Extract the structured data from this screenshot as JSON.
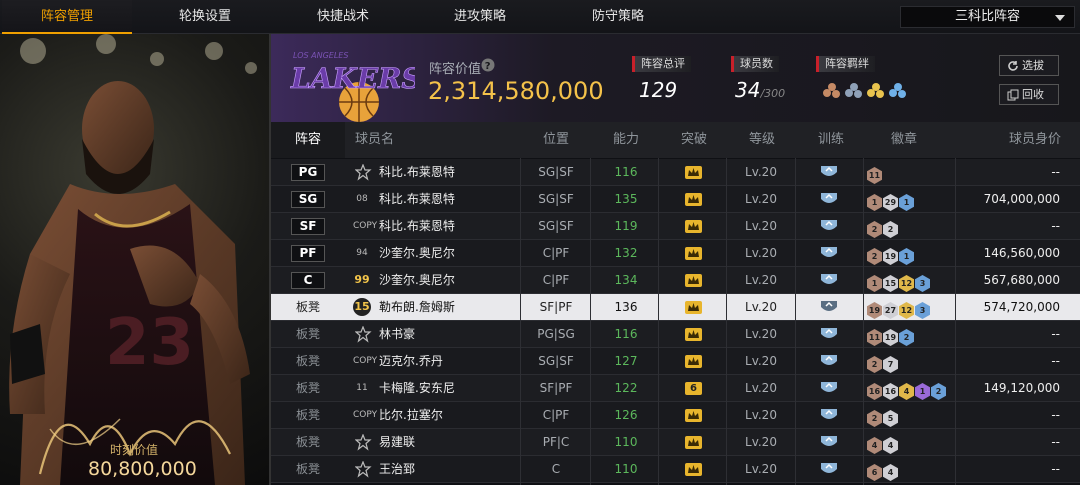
{
  "nav": {
    "tabs": [
      "阵容管理",
      "轮换设置",
      "快捷战术",
      "进攻策略",
      "防守策略"
    ],
    "active": 0,
    "dropdown": "三科比阵容"
  },
  "hero": {
    "value_caption": "时刻价值",
    "value": "80,800,000",
    "jersey": "23"
  },
  "summary": {
    "team_logo_text": "LAKERS",
    "team_logo_subtext": "LOS ANGELES",
    "value_label": "阵容价值",
    "value": "2,314,580,000",
    "rating_label": "阵容总评",
    "rating": "129",
    "players_label": "球员数",
    "players": "34",
    "players_max": "/300",
    "bonds_label": "阵容羁绊",
    "btn_pick": "选拔",
    "btn_recycle": "回收"
  },
  "table": {
    "headers": [
      "阵容",
      "球员名",
      "位置",
      "能力",
      "突破",
      "等级",
      "训练",
      "徽章",
      "球员身价"
    ],
    "rows": [
      {
        "slot": "PG",
        "starter": true,
        "num": "★",
        "name": "科比.布莱恩特",
        "pos": "SG|SF",
        "ability": "116",
        "break": "",
        "level": "Lv.20",
        "badges": [
          {
            "n": "11",
            "c": "#b08a78"
          }
        ],
        "price": "--"
      },
      {
        "slot": "SG",
        "starter": true,
        "num": "08",
        "name": "科比.布莱恩特",
        "pos": "SG|SF",
        "ability": "135",
        "break": "",
        "level": "Lv.20",
        "badges": [
          {
            "n": "1",
            "c": "#b08a78"
          },
          {
            "n": "29",
            "c": "#cfcfd4"
          },
          {
            "n": "1",
            "c": "#6aa0d8"
          }
        ],
        "price": "704,000,000"
      },
      {
        "slot": "SF",
        "starter": true,
        "num": "COPY",
        "name": "科比.布莱恩特",
        "pos": "SG|SF",
        "ability": "119",
        "break": "",
        "level": "Lv.20",
        "badges": [
          {
            "n": "2",
            "c": "#b08a78"
          },
          {
            "n": "2",
            "c": "#cfcfd4"
          }
        ],
        "price": "--"
      },
      {
        "slot": "PF",
        "starter": true,
        "num": "94",
        "name": "沙奎尔.奥尼尔",
        "pos": "C|PF",
        "ability": "132",
        "break": "",
        "level": "Lv.20",
        "badges": [
          {
            "n": "2",
            "c": "#b08a78"
          },
          {
            "n": "19",
            "c": "#cfcfd4"
          },
          {
            "n": "1",
            "c": "#6aa0d8"
          }
        ],
        "price": "146,560,000"
      },
      {
        "slot": "C",
        "starter": true,
        "num": "99",
        "name": "沙奎尔.奥尼尔",
        "pos": "C|PF",
        "ability": "134",
        "break": "",
        "level": "Lv.20",
        "badges": [
          {
            "n": "1",
            "c": "#b08a78"
          },
          {
            "n": "15",
            "c": "#cfcfd4"
          },
          {
            "n": "12",
            "c": "#e0b84a"
          },
          {
            "n": "3",
            "c": "#6aa0d8"
          }
        ],
        "price": "567,680,000"
      },
      {
        "slot": "板凳",
        "starter": false,
        "num": "15",
        "name": "勒布朗.詹姆斯",
        "pos": "SF|PF",
        "ability": "136",
        "break": "",
        "level": "Lv.20",
        "badges": [
          {
            "n": "19",
            "c": "#b08a78"
          },
          {
            "n": "27",
            "c": "#cfcfd4"
          },
          {
            "n": "12",
            "c": "#e0b84a"
          },
          {
            "n": "3",
            "c": "#6aa0d8"
          }
        ],
        "price": "574,720,000",
        "selected": true
      },
      {
        "slot": "板凳",
        "starter": false,
        "num": "★",
        "name": "林书豪",
        "pos": "PG|SG",
        "ability": "116",
        "break": "",
        "level": "Lv.20",
        "badges": [
          {
            "n": "11",
            "c": "#b08a78"
          },
          {
            "n": "19",
            "c": "#cfcfd4"
          },
          {
            "n": "2",
            "c": "#6aa0d8"
          }
        ],
        "price": "--"
      },
      {
        "slot": "板凳",
        "starter": false,
        "num": "COPY",
        "name": "迈克尔.乔丹",
        "pos": "SG|SF",
        "ability": "127",
        "break": "",
        "level": "Lv.20",
        "badges": [
          {
            "n": "2",
            "c": "#b08a78"
          },
          {
            "n": "7",
            "c": "#cfcfd4"
          }
        ],
        "price": "--"
      },
      {
        "slot": "板凳",
        "starter": false,
        "num": "11",
        "name": "卡梅隆.安东尼",
        "pos": "SF|PF",
        "ability": "122",
        "break": "6",
        "level": "Lv.20",
        "badges": [
          {
            "n": "16",
            "c": "#b08a78"
          },
          {
            "n": "16",
            "c": "#cfcfd4"
          },
          {
            "n": "4",
            "c": "#e0b84a"
          },
          {
            "n": "1",
            "c": "#9a6ad8"
          },
          {
            "n": "2",
            "c": "#6aa0d8"
          }
        ],
        "price": "149,120,000"
      },
      {
        "slot": "板凳",
        "starter": false,
        "num": "COPY",
        "name": "比尔.拉塞尔",
        "pos": "C|PF",
        "ability": "126",
        "break": "",
        "level": "Lv.20",
        "badges": [
          {
            "n": "2",
            "c": "#b08a78"
          },
          {
            "n": "5",
            "c": "#cfcfd4"
          }
        ],
        "price": "--"
      },
      {
        "slot": "板凳",
        "starter": false,
        "num": "★",
        "name": "易建联",
        "pos": "PF|C",
        "ability": "110",
        "break": "",
        "level": "Lv.20",
        "badges": [
          {
            "n": "4",
            "c": "#b08a78"
          },
          {
            "n": "4",
            "c": "#cfcfd4"
          }
        ],
        "price": "--"
      },
      {
        "slot": "板凳",
        "starter": false,
        "num": "★",
        "name": "王治郅",
        "pos": "C",
        "ability": "110",
        "break": "",
        "level": "Lv.20",
        "badges": [
          {
            "n": "6",
            "c": "#b08a78"
          },
          {
            "n": "4",
            "c": "#cfcfd4"
          }
        ],
        "price": "--"
      }
    ]
  }
}
